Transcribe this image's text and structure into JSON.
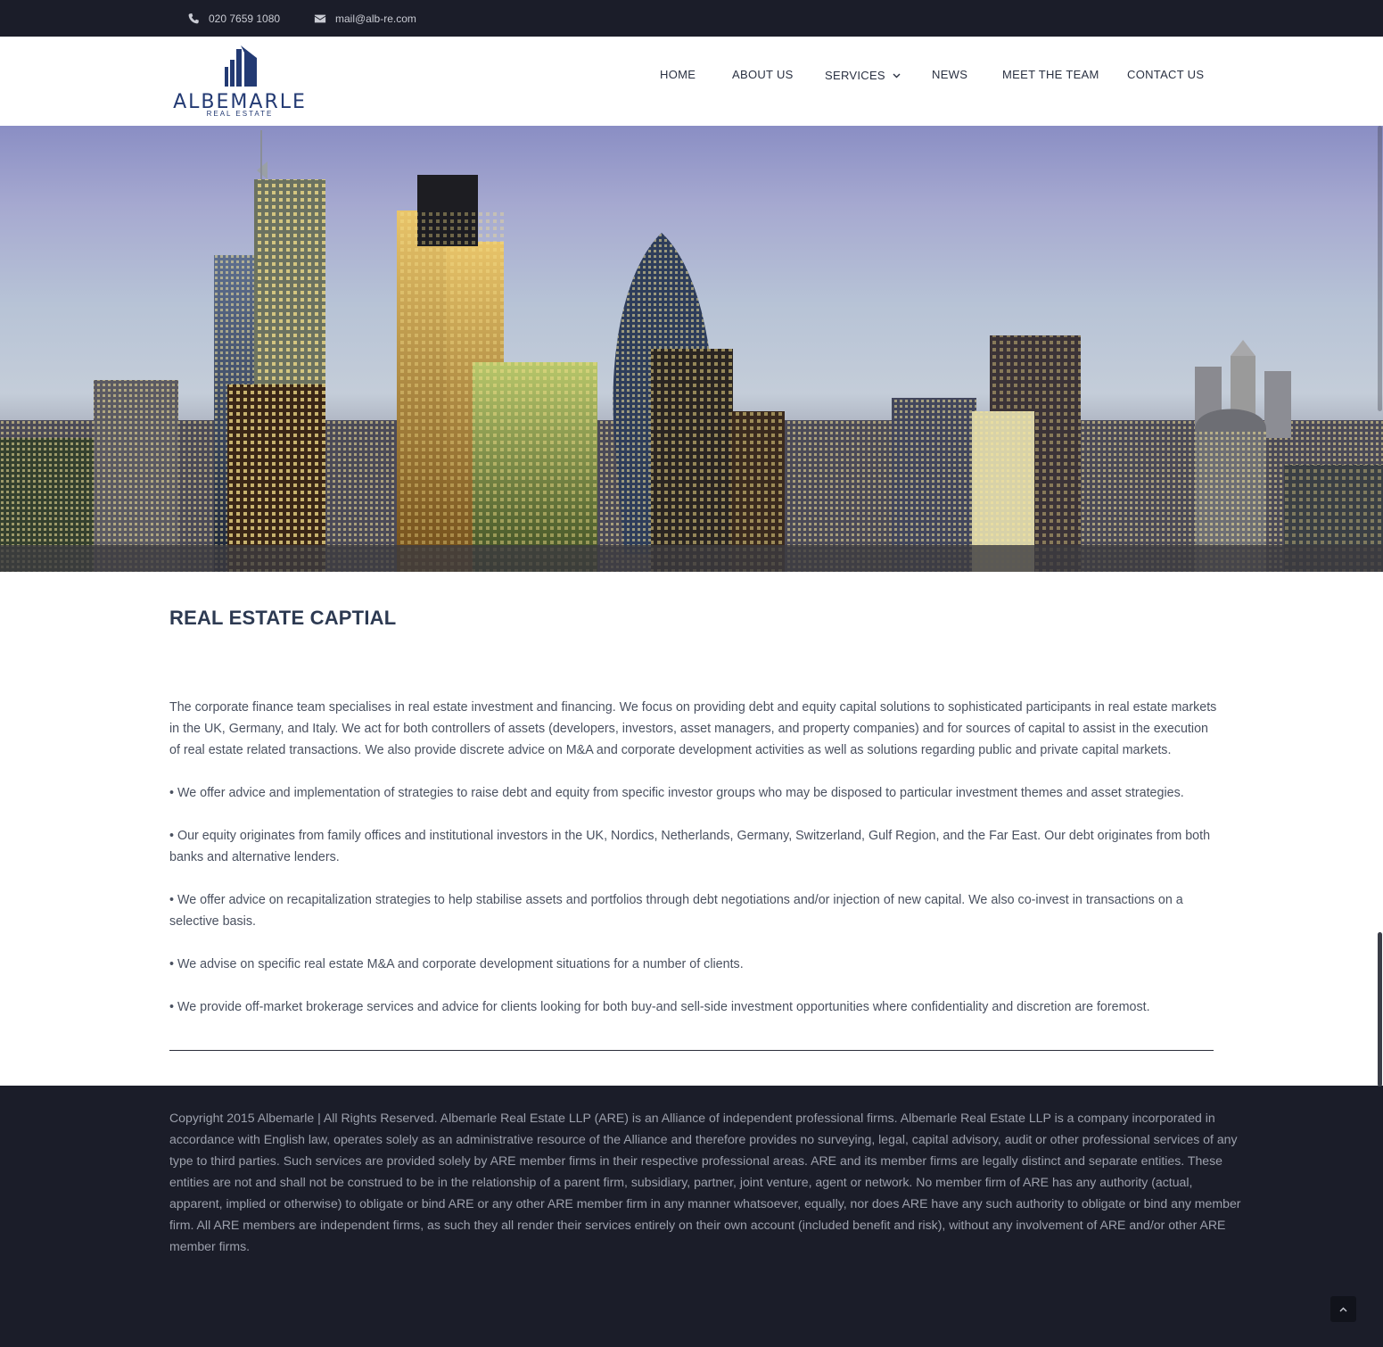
{
  "topbar": {
    "phone_icon": "phone-icon",
    "phone": "020 7659 1080",
    "email_icon": "envelope-icon",
    "email": "mail@alb-re.com"
  },
  "logo": {
    "name": "ALBEMARLE",
    "sub": "REAL ESTATE"
  },
  "nav": {
    "items": [
      {
        "label": "HOME"
      },
      {
        "label": "ABOUT US"
      },
      {
        "label": "SERVICES",
        "icon": "chevron-down-icon"
      },
      {
        "label": "NEWS"
      },
      {
        "label": "MEET THE TEAM"
      },
      {
        "label": "CONTACT US"
      }
    ]
  },
  "hero": {
    "image": "city-skyline-image"
  },
  "content": {
    "title": "REAL ESTATE CAPTIAL",
    "paragraphs": [
      "The corporate finance team specialises in real estate investment and financing. We focus on providing debt and equity capital solutions to sophisticated participants in real estate markets in the UK, Germany, and Italy. We act for both controllers of assets (developers, investors, asset managers, and property companies) and for sources of capital to assist in the execution of real estate related transactions. We also provide discrete advice on M&A and corporate development activities as well as solutions regarding public and private capital markets.",
      "• We offer advice and implementation of strategies to raise debt and equity from specific investor groups who may be disposed to particular investment themes and asset strategies.",
      "• Our equity originates from family offices and institutional investors in the UK, Nordics, Netherlands, Germany, Switzerland, Gulf Region, and the Far East. Our debt originates from both banks and alternative lenders.",
      "• We offer advice on recapitalization strategies to help stabilise assets and portfolios through debt negotiations and/or injection of new capital. We also co-invest in transactions on a selective basis.",
      "• We advise on specific real estate M&A and corporate development situations for a number of clients.",
      "• We provide off-market brokerage services and advice for clients looking for both buy-and sell-side investment opportunities where confidentiality and discretion are foremost."
    ]
  },
  "footer": {
    "copyright": "Copyright 2015 Albemarle | All Rights Reserved. Albemarle Real Estate LLP (ARE) is an Alliance of independent professional firms. Albemarle Real Estate LLP is a company incorporated in accordance with English law, operates solely as an administrative resource of the Alliance and therefore provides no surveying, legal, capital advisory, audit or other professional services of any type to third parties. Such services are provided solely by ARE member firms in their respective professional areas. ARE and its member firms are legally distinct and separate entities. These entities are not and shall not be construed to be in the relationship of a parent firm, subsidiary, partner, joint venture, agent or network. No member firm of ARE has any authority (actual, apparent, implied or otherwise) to obligate or bind ARE or any other ARE member firm in any manner whatsoever, equally, nor does ARE have any such authority to obligate or bind any member firm. All ARE members are independent firms, as such they all render their services entirely on their own account (included benefit and risk), without any involvement of ARE and/or other ARE member firms.",
    "back_to_top_icon": "chevron-up-icon"
  },
  "colors": {
    "topbar_bg": "#1b1d29",
    "brand_blue": "#233a73",
    "heading": "#2d3a52",
    "body_text": "#4a5160",
    "footer_text": "#9ca0ac"
  }
}
